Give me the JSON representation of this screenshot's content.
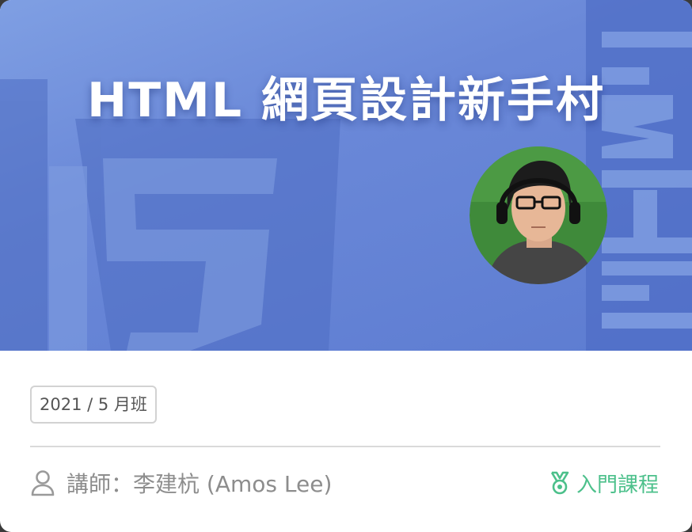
{
  "banner": {
    "title": "HTML 網頁設計新手村",
    "background_color": "#6a88d8"
  },
  "course": {
    "class_tag": "2021 / 5 月班",
    "instructor_prefix": "講師：",
    "instructor_name": "李建杭 (Amos Lee)",
    "level_label": "入門課程",
    "level_color": "#4cc08b"
  },
  "icons": {
    "user": "user-icon",
    "level": "medal-icon"
  }
}
